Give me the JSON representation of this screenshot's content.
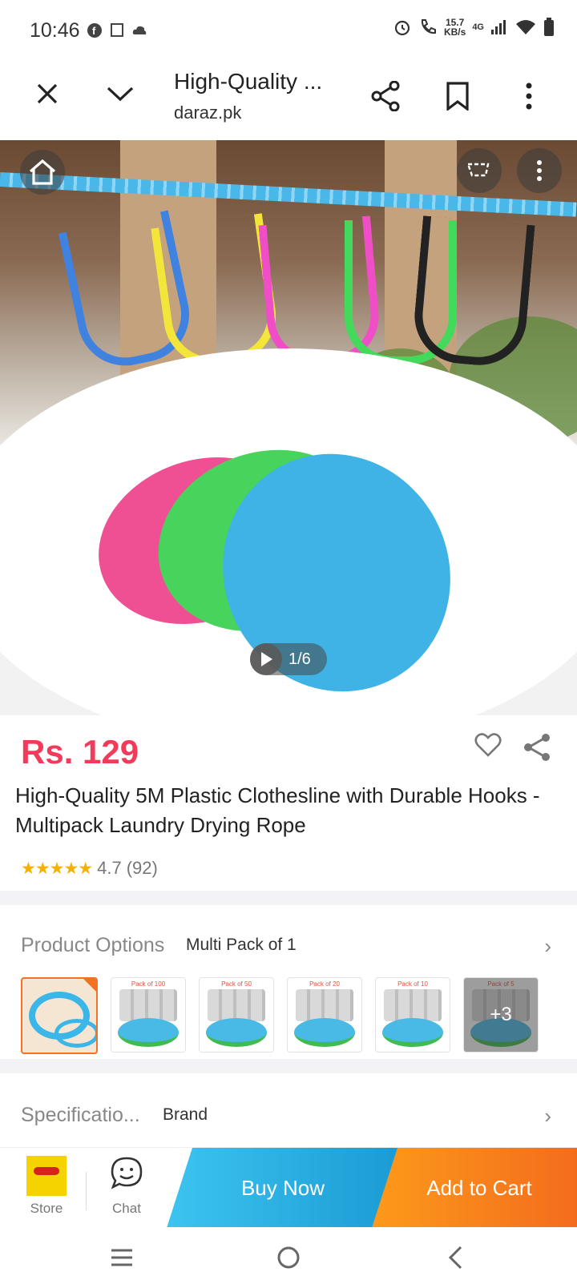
{
  "status_bar": {
    "time": "10:46",
    "speed_value": "15.7",
    "speed_unit": "KB/s",
    "network": "4G",
    "icons": [
      "facebook-icon",
      "screen-icon",
      "cloud-icon",
      "alarm-icon",
      "wifi-call-icon",
      "signal-icon",
      "wifi-icon",
      "battery-icon"
    ]
  },
  "browser": {
    "title": "High-Quality ...",
    "domain": "daraz.pk",
    "icons": [
      "close-icon",
      "chevron-down-icon",
      "share-icon",
      "bookmark-icon",
      "more-icon"
    ]
  },
  "gallery": {
    "counter": "1/6",
    "icons": [
      "home-icon",
      "cart-icon",
      "more-icon",
      "play-icon"
    ]
  },
  "product": {
    "price": "Rs. 129",
    "title": "High-Quality 5M Plastic Clothesline with Durable Hooks - Multipack Laundry Drying Rope",
    "rating": "4.7",
    "reviews": "(92)",
    "stars": "★★★★★"
  },
  "options": {
    "label": "Product Options",
    "value": "Multi Pack of 1",
    "thumbnails": [
      {
        "label": "",
        "selected": true
      },
      {
        "label": "Pack of 100"
      },
      {
        "label": "Pack of 50"
      },
      {
        "label": "Pack of 20"
      },
      {
        "label": "Pack of 10"
      },
      {
        "label": "Pack of 5",
        "more": "+3"
      }
    ]
  },
  "specifications": {
    "label": "Specificatio...",
    "value": "Brand"
  },
  "bottom_bar": {
    "store_label": "Store",
    "chat_label": "Chat",
    "buy_now": "Buy Now",
    "add_to_cart": "Add to Cart",
    "colors": {
      "buy": "#1b9bd4",
      "cart": "#f36c1d",
      "price": "#f23b5b"
    }
  },
  "nav": {
    "icons": [
      "recents-icon",
      "home-nav-icon",
      "back-icon"
    ]
  }
}
